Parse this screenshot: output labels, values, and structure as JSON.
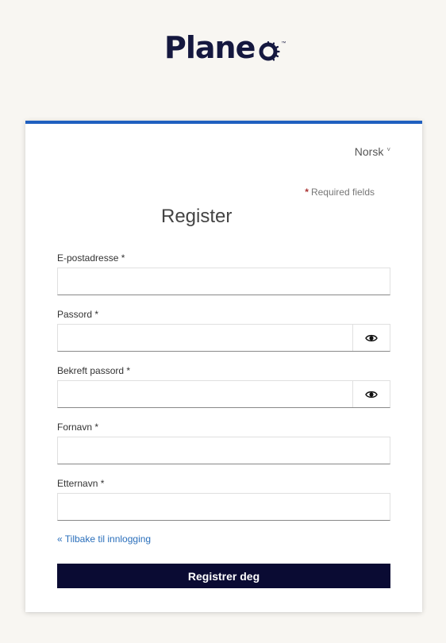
{
  "brand": {
    "name": "Plane",
    "trademark": "™"
  },
  "language": {
    "selected": "Norsk",
    "caret": "˅"
  },
  "required_note": {
    "star": "*",
    "text": "Required fields"
  },
  "form": {
    "title": "Register",
    "fields": [
      {
        "label": "E-postadresse *",
        "value": "",
        "type": "email"
      },
      {
        "label": "Passord *",
        "value": "",
        "type": "password"
      },
      {
        "label": "Bekreft passord *",
        "value": "",
        "type": "password"
      },
      {
        "label": "Fornavn *",
        "value": "",
        "type": "text"
      },
      {
        "label": "Etternavn *",
        "value": "",
        "type": "text"
      }
    ],
    "back_link": "« Tilbake til innlogging",
    "submit_label": "Registrer deg"
  },
  "colors": {
    "accent": "#1f5fbf",
    "brand": "#15183f",
    "button": "#0a0b33",
    "link": "#2a6fbb"
  },
  "icons": {
    "password_toggle": "eye-icon"
  }
}
